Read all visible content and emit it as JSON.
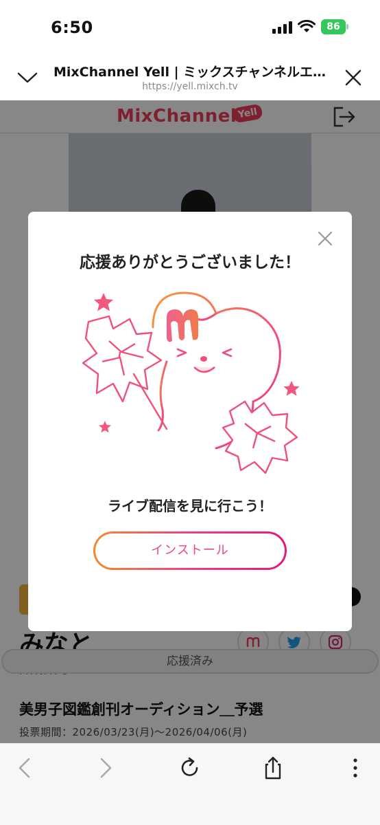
{
  "status": {
    "time": "6:50",
    "battery": "86"
  },
  "browser": {
    "title": "MixChannel Yell | ミックスチャンネルエ…",
    "url": "https://yell.mixch.tv"
  },
  "site": {
    "logo_text": "MixChannel",
    "logo_badge": "Yell",
    "star_name": "みなと",
    "star_name_en": "MINATO",
    "cheered_label": "応援済み",
    "audition_title": "美男子図鑑創刊オーディション＿予選",
    "vote_period": "投票期間：2026/03/23(月)〜2026/04/06(月)"
  },
  "modal": {
    "title": "応援ありがとうございました！",
    "subtitle": "ライブ配信を見に行こう！",
    "install_label": "インストール"
  },
  "colors": {
    "accent": "#ef3e5a",
    "battery": "#34c759"
  },
  "icons": {
    "header_left": "chevron-down-icon",
    "header_right": "close-icon",
    "toolbar": [
      "back-icon",
      "forward-icon",
      "reload-icon",
      "share-icon",
      "more-icon"
    ]
  }
}
